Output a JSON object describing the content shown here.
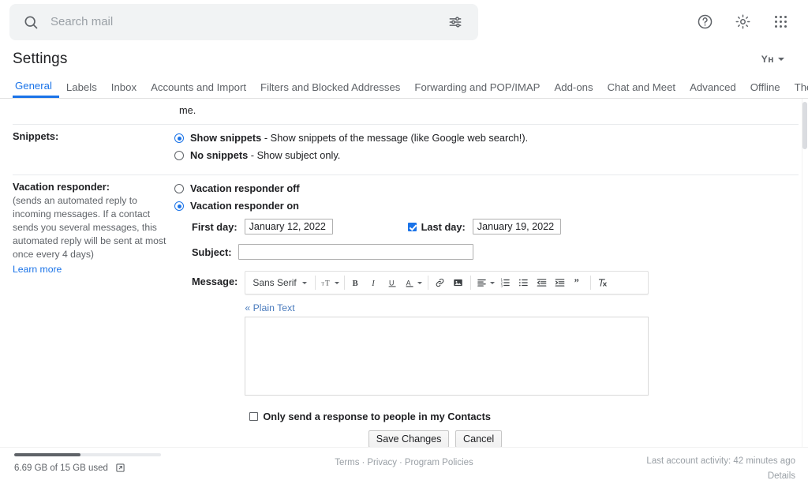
{
  "search": {
    "placeholder": "Search mail",
    "value": "",
    "search_icon": "search-icon",
    "tune_icon": "tune-icon"
  },
  "topbar": {
    "help_icon": "help-icon",
    "settings_icon": "gear-icon",
    "apps_icon": "apps-grid-icon"
  },
  "header": {
    "title": "Settings",
    "language_indicator": "Yн"
  },
  "tabs": [
    {
      "label": "General",
      "active": true
    },
    {
      "label": "Labels",
      "active": false
    },
    {
      "label": "Inbox",
      "active": false
    },
    {
      "label": "Accounts and Import",
      "active": false
    },
    {
      "label": "Filters and Blocked Addresses",
      "active": false
    },
    {
      "label": "Forwarding and POP/IMAP",
      "active": false
    },
    {
      "label": "Add-ons",
      "active": false
    },
    {
      "label": "Chat and Meet",
      "active": false
    },
    {
      "label": "Advanced",
      "active": false
    },
    {
      "label": "Offline",
      "active": false
    },
    {
      "label": "Themes",
      "active": false
    }
  ],
  "partial_row": {
    "text": "me."
  },
  "snippets": {
    "label": "Snippets:",
    "options": [
      {
        "bold": "Show snippets",
        "rest": " - Show snippets of the message (like Google web search!).",
        "checked": true
      },
      {
        "bold": "No snippets",
        "rest": " - Show subject only.",
        "checked": false
      }
    ]
  },
  "vacation": {
    "label": "Vacation responder:",
    "description": "(sends an automated reply to incoming messages. If a contact sends you several messages, this automated reply will be sent at most once every 4 days)",
    "learn_more": "Learn more",
    "off_label": "Vacation responder off",
    "on_label": "Vacation responder on",
    "off_checked": false,
    "on_checked": true,
    "first_day_label": "First day:",
    "first_day_value": "January 12, 2022",
    "last_day_label": "Last day:",
    "last_day_value": "January 19, 2022",
    "last_day_checked": true,
    "subject_label": "Subject:",
    "subject_value": "",
    "message_label": "Message:",
    "message_value": "",
    "plain_text_link": "« Plain Text",
    "contacts_only_label": "Only send a response to people in my Contacts",
    "contacts_only_checked": false
  },
  "editor_toolbar": {
    "font_name": "Sans Serif",
    "buttons": [
      {
        "name": "font-size-icon",
        "glyph": "T"
      },
      {
        "name": "bold-icon",
        "glyph": "B"
      },
      {
        "name": "italic-icon",
        "glyph": "I"
      },
      {
        "name": "underline-icon",
        "glyph": "U"
      },
      {
        "name": "text-color-icon",
        "glyph": "A"
      },
      {
        "name": "link-icon",
        "glyph": "🔗"
      },
      {
        "name": "insert-image-icon",
        "glyph": "🖼"
      },
      {
        "name": "align-icon",
        "glyph": "≡"
      },
      {
        "name": "numbered-list-icon",
        "glyph": "1."
      },
      {
        "name": "bulleted-list-icon",
        "glyph": "•"
      },
      {
        "name": "outdent-icon",
        "glyph": "⇤"
      },
      {
        "name": "indent-icon",
        "glyph": "⇥"
      },
      {
        "name": "quote-icon",
        "glyph": "”"
      },
      {
        "name": "remove-formatting-icon",
        "glyph": "T✕"
      }
    ]
  },
  "actions": {
    "save_label": "Save Changes",
    "cancel_label": "Cancel"
  },
  "footer": {
    "storage_text": "6.69 GB of 15 GB used",
    "storage_percent": 45,
    "storage_link_icon": "external-link-icon",
    "legal": [
      "Terms",
      "Privacy",
      "Program Policies"
    ],
    "activity_text": "Last account activity: 42 minutes ago",
    "details_label": "Details"
  },
  "colors": {
    "accent": "#1a73e8",
    "muted": "#5f6368",
    "placeholder": "#9aa0a6"
  }
}
